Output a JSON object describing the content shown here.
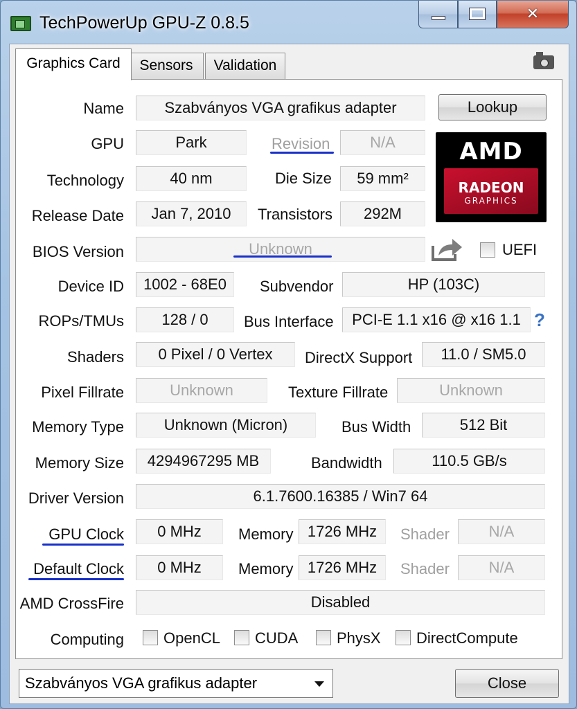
{
  "window": {
    "title": "TechPowerUp GPU-Z 0.8.5",
    "close_glyph": "✕"
  },
  "tabs": [
    {
      "label": "Graphics Card",
      "active": true
    },
    {
      "label": "Sensors",
      "active": false
    },
    {
      "label": "Validation",
      "active": false
    }
  ],
  "fields": {
    "name": {
      "label": "Name",
      "value": "Szabványos VGA grafikus adapter"
    },
    "gpu": {
      "label": "GPU",
      "value": "Park"
    },
    "revision": {
      "label": "Revision",
      "value": "N/A"
    },
    "technology": {
      "label": "Technology",
      "value": "40 nm"
    },
    "die_size": {
      "label": "Die Size",
      "value": "59 mm²"
    },
    "release_date": {
      "label": "Release Date",
      "value": "Jan 7, 2010"
    },
    "transistors": {
      "label": "Transistors",
      "value": "292M"
    },
    "bios_version": {
      "label": "BIOS Version",
      "value": "Unknown"
    },
    "uefi": {
      "label": "UEFI",
      "checked": false
    },
    "device_id": {
      "label": "Device ID",
      "value": "1002 - 68E0"
    },
    "subvendor": {
      "label": "Subvendor",
      "value": "HP (103C)"
    },
    "rops_tmus": {
      "label": "ROPs/TMUs",
      "value": "128 / 0"
    },
    "bus_interface": {
      "label": "Bus Interface",
      "value": "PCI-E 1.1 x16 @ x16 1.1"
    },
    "help_glyph": "?",
    "shaders": {
      "label": "Shaders",
      "value": "0 Pixel / 0 Vertex"
    },
    "directx": {
      "label": "DirectX Support",
      "value": "11.0 / SM5.0"
    },
    "pixel_fillrate": {
      "label": "Pixel Fillrate",
      "value": "Unknown"
    },
    "texture_fillrate": {
      "label": "Texture Fillrate",
      "value": "Unknown"
    },
    "memory_type": {
      "label": "Memory Type",
      "value": "Unknown (Micron)"
    },
    "bus_width": {
      "label": "Bus Width",
      "value": "512 Bit"
    },
    "memory_size": {
      "label": "Memory Size",
      "value": "4294967295 MB"
    },
    "bandwidth": {
      "label": "Bandwidth",
      "value": "110.5 GB/s"
    },
    "driver_version": {
      "label": "Driver Version",
      "value": "6.1.7600.16385 / Win7 64"
    },
    "gpu_clock": {
      "label": "GPU Clock",
      "value": "0 MHz",
      "memory_label": "Memory",
      "memory_value": "1726 MHz",
      "shader_label": "Shader",
      "shader_value": "N/A"
    },
    "default_clock": {
      "label": "Default Clock",
      "value": "0 MHz",
      "memory_label": "Memory",
      "memory_value": "1726 MHz",
      "shader_label": "Shader",
      "shader_value": "N/A"
    },
    "crossfire": {
      "label": "AMD CrossFire",
      "value": "Disabled"
    }
  },
  "computing": {
    "label": "Computing",
    "options": [
      {
        "label": "OpenCL",
        "checked": false
      },
      {
        "label": "CUDA",
        "checked": false
      },
      {
        "label": "PhysX",
        "checked": false
      },
      {
        "label": "DirectCompute",
        "checked": false
      }
    ]
  },
  "buttons": {
    "lookup": "Lookup",
    "close": "Close"
  },
  "logo": {
    "brand": "AMD",
    "line1": "RADEON",
    "line2": "GRAPHICS"
  },
  "adapter_select": {
    "selected": "Szabványos VGA grafikus adapter"
  },
  "colors": {
    "annotation_underline": "#1830c8",
    "amd_red": "#c8102e"
  }
}
